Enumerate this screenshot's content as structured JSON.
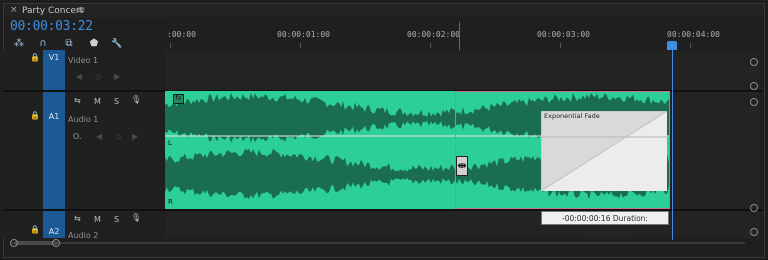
{
  "window": {
    "close_glyph": "×",
    "title": "Party Concert",
    "menu_glyph": "≡"
  },
  "timecode": "00:00:03:22",
  "toolbar": [
    {
      "name": "snap-icon",
      "glyph": "⁂"
    },
    {
      "name": "magnet-icon",
      "glyph": "∩"
    },
    {
      "name": "linked-selection-icon",
      "glyph": "⧉"
    },
    {
      "name": "marker-icon",
      "glyph": "⬟"
    },
    {
      "name": "wrench-icon",
      "glyph": "🔧"
    }
  ],
  "ruler": {
    "labels": [
      ":00:00",
      "00:00:01:00",
      "00:00:02:00",
      "00:00:03:00",
      "00:00:04:00"
    ]
  },
  "tracks": {
    "v1": {
      "id": "V1",
      "name": "Video 1"
    },
    "a1": {
      "id": "A1",
      "name": "Audio 1",
      "toggle_m": "M",
      "toggle_s": "S"
    },
    "a2": {
      "id": "A2",
      "name": "Audio 2",
      "toggle_m": "M",
      "toggle_s": "S"
    }
  },
  "clip": {
    "fx_badge": "fx",
    "channel_l": "L",
    "channel_r": "R",
    "transition_label": "Exponential Fade"
  },
  "tooltip": "-00:00:00:16 Duration: 00:00:01:16",
  "colors": {
    "accent": "#3f8fe0",
    "clip": "#2ccf95",
    "clip_dark": "#1a6e4f",
    "selection": "#d0708a",
    "track_label": "#1c5a96"
  }
}
